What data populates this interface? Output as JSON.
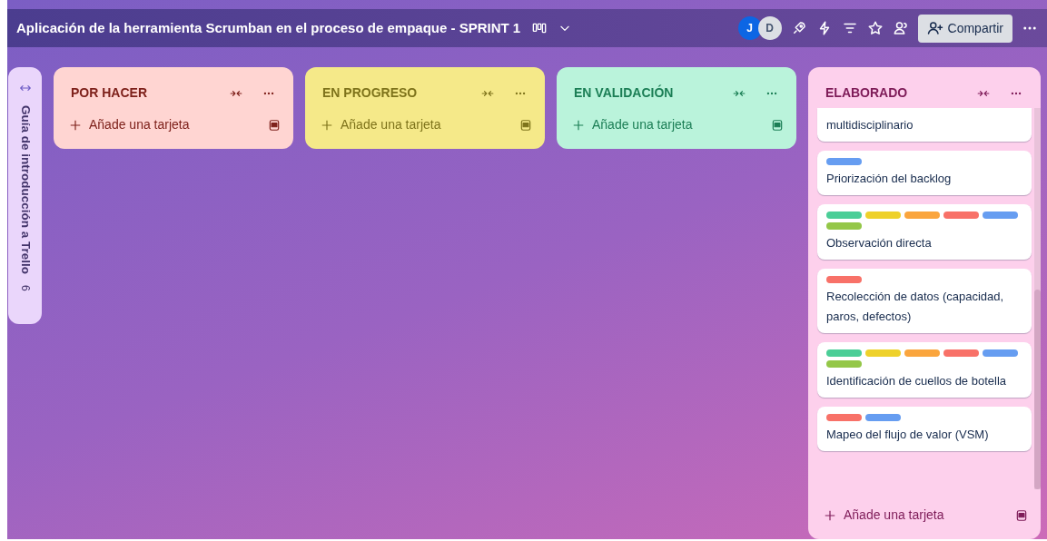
{
  "board": {
    "title": "Aplicación de la herramienta Scrumban en el proceso de empaque - SPRINT 1",
    "members": [
      {
        "initial": "J",
        "color": "#0c66e4"
      },
      {
        "initial": "D",
        "color": "#dcdfe4"
      }
    ],
    "share_button": "Compartir"
  },
  "sidebar_list": {
    "title": "Guía de introducción a Trello",
    "count": "6"
  },
  "lists": [
    {
      "title": "POR HACER",
      "color": "#ffd5d2",
      "add_card": "Añade una tarjeta"
    },
    {
      "title": "EN PROGRESO",
      "color": "#f5e989",
      "add_card": "Añade una tarjeta"
    },
    {
      "title": "EN VALIDACIÓN",
      "color": "#baf3db",
      "add_card": "Añade una tarjeta"
    },
    {
      "title": "ELABORADO",
      "color": "#fdd0ec",
      "add_card": "Añade una tarjeta",
      "cards": [
        {
          "title": "multidisciplinario"
        },
        {
          "title": "Priorización del backlog",
          "labels": [
            {
              "color": "#669df1"
            }
          ]
        },
        {
          "title": "Observación directa",
          "labels": [
            {
              "color": "#4bce97"
            },
            {
              "color": "#eed12b"
            },
            {
              "color": "#faa53d"
            },
            {
              "color": "#f87168"
            },
            {
              "color": "#669df1"
            },
            {
              "color": "#94c748"
            }
          ]
        },
        {
          "title": "Recolección de datos (capacidad, paros, defectos)",
          "labels": [
            {
              "color": "#f87168"
            }
          ]
        },
        {
          "title": "Identificación de cuellos de botella",
          "labels": [
            {
              "color": "#4bce97"
            },
            {
              "color": "#eed12b"
            },
            {
              "color": "#faa53d"
            },
            {
              "color": "#f87168"
            },
            {
              "color": "#669df1"
            },
            {
              "color": "#94c748"
            }
          ]
        },
        {
          "title": "Mapeo del flujo de valor (VSM)",
          "labels": [
            {
              "color": "#f87168"
            },
            {
              "color": "#669df1"
            }
          ]
        }
      ]
    }
  ]
}
